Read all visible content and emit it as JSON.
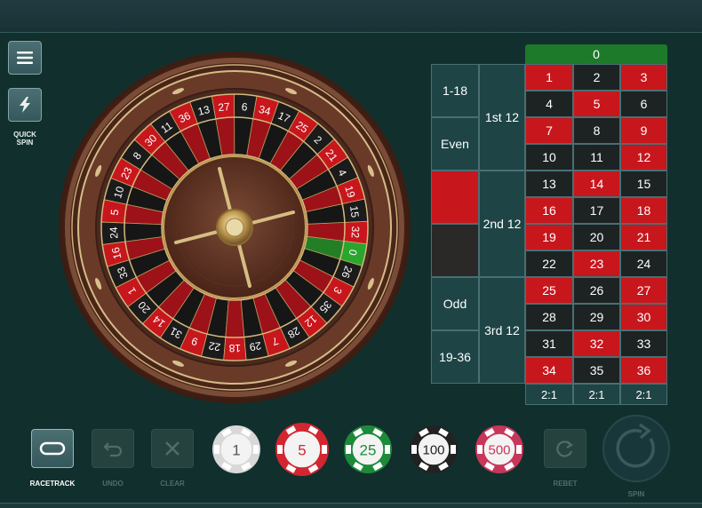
{
  "sidebar": {
    "menu_icon": "hamburger-icon",
    "quick_spin_icon": "lightning-icon",
    "quick_spin_label_line1": "QUICK",
    "quick_spin_label_line2": "SPIN"
  },
  "wheel": {
    "sequence": [
      "0",
      "32",
      "15",
      "19",
      "4",
      "21",
      "2",
      "25",
      "17",
      "34",
      "6",
      "27",
      "13",
      "36",
      "11",
      "30",
      "8",
      "23",
      "10",
      "5",
      "24",
      "16",
      "33",
      "1",
      "20",
      "14",
      "31",
      "9",
      "22",
      "18",
      "29",
      "7",
      "28",
      "12",
      "35",
      "3",
      "26"
    ],
    "red_numbers": [
      "32",
      "19",
      "21",
      "25",
      "34",
      "27",
      "36",
      "30",
      "23",
      "5",
      "16",
      "1",
      "14",
      "9",
      "18",
      "7",
      "12",
      "3"
    ]
  },
  "table": {
    "zero": "0",
    "rows": [
      [
        {
          "n": "1",
          "c": "red"
        },
        {
          "n": "2",
          "c": "black"
        },
        {
          "n": "3",
          "c": "red"
        }
      ],
      [
        {
          "n": "4",
          "c": "black"
        },
        {
          "n": "5",
          "c": "red"
        },
        {
          "n": "6",
          "c": "black"
        }
      ],
      [
        {
          "n": "7",
          "c": "red"
        },
        {
          "n": "8",
          "c": "black"
        },
        {
          "n": "9",
          "c": "red"
        }
      ],
      [
        {
          "n": "10",
          "c": "black"
        },
        {
          "n": "11",
          "c": "black"
        },
        {
          "n": "12",
          "c": "red"
        }
      ],
      [
        {
          "n": "13",
          "c": "black"
        },
        {
          "n": "14",
          "c": "red"
        },
        {
          "n": "15",
          "c": "black"
        }
      ],
      [
        {
          "n": "16",
          "c": "red"
        },
        {
          "n": "17",
          "c": "black"
        },
        {
          "n": "18",
          "c": "red"
        }
      ],
      [
        {
          "n": "19",
          "c": "red"
        },
        {
          "n": "20",
          "c": "black"
        },
        {
          "n": "21",
          "c": "red"
        }
      ],
      [
        {
          "n": "22",
          "c": "black"
        },
        {
          "n": "23",
          "c": "red"
        },
        {
          "n": "24",
          "c": "black"
        }
      ],
      [
        {
          "n": "25",
          "c": "red"
        },
        {
          "n": "26",
          "c": "black"
        },
        {
          "n": "27",
          "c": "red"
        }
      ],
      [
        {
          "n": "28",
          "c": "black"
        },
        {
          "n": "29",
          "c": "black"
        },
        {
          "n": "30",
          "c": "red"
        }
      ],
      [
        {
          "n": "31",
          "c": "black"
        },
        {
          "n": "32",
          "c": "red"
        },
        {
          "n": "33",
          "c": "black"
        }
      ],
      [
        {
          "n": "34",
          "c": "red"
        },
        {
          "n": "35",
          "c": "black"
        },
        {
          "n": "36",
          "c": "red"
        }
      ]
    ],
    "columns": [
      "2:1",
      "2:1",
      "2:1"
    ],
    "dozens": [
      "1st 12",
      "2nd 12",
      "3rd 12"
    ],
    "outside": {
      "low": "1-18",
      "even": "Even",
      "red": "",
      "black": "",
      "odd": "Odd",
      "high": "19-36"
    }
  },
  "controls": {
    "racetrack": "RACETRACK",
    "undo": "UNDO",
    "clear": "CLEAR",
    "rebet": "REBET",
    "spin": "SPIN"
  },
  "chips": [
    {
      "value": "1",
      "color": "#d8d8d8",
      "text_color": "#555555"
    },
    {
      "value": "5",
      "color": "#d22630",
      "text_color": "#d22630"
    },
    {
      "value": "25",
      "color": "#1d8a3a",
      "text_color": "#1d8a3a"
    },
    {
      "value": "100",
      "color": "#222222",
      "text_color": "#222222"
    },
    {
      "value": "500",
      "color": "#c8365a",
      "text_color": "#c8365a"
    }
  ],
  "colors": {
    "background": "#11302d",
    "red": "#c8161d",
    "black": "#1d2323",
    "green": "#1c7a2a"
  }
}
